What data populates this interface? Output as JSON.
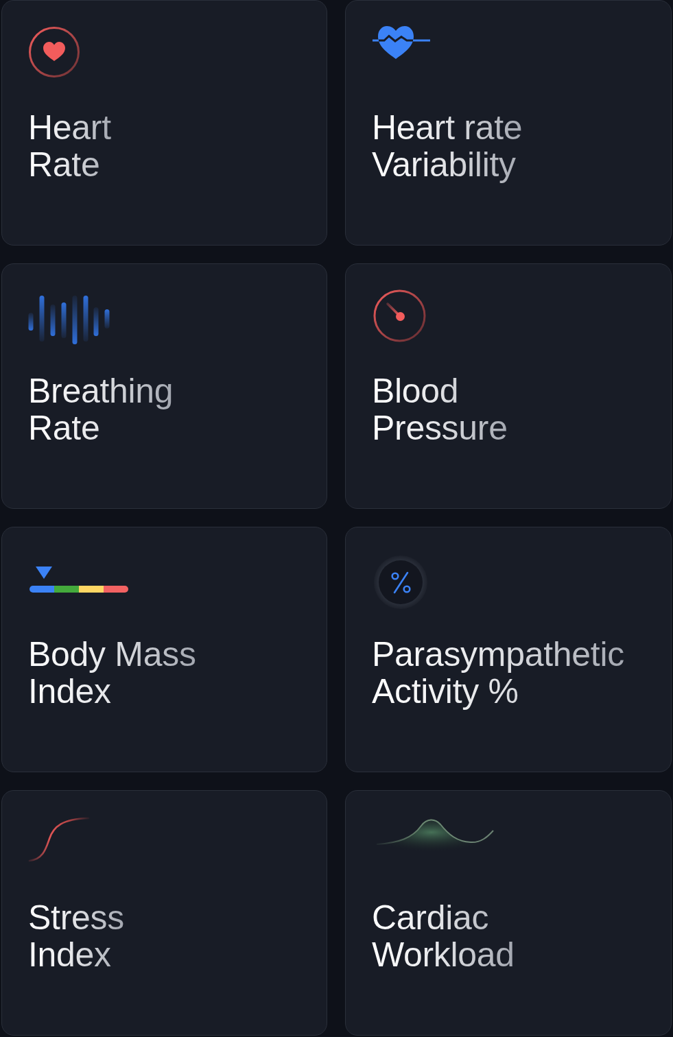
{
  "cards": [
    {
      "kind": "heart_rate",
      "title_lines": [
        "Heart",
        "Rate"
      ]
    },
    {
      "kind": "hrv",
      "title_lines": [
        "Heart rate",
        "Variability"
      ]
    },
    {
      "kind": "breathing",
      "title_lines": [
        "Breathing",
        "Rate"
      ]
    },
    {
      "kind": "blood_pressure",
      "title_lines": [
        "Blood",
        "Pressure"
      ]
    },
    {
      "kind": "bmi",
      "title_lines": [
        "Body Mass",
        "Index"
      ]
    },
    {
      "kind": "parasympathetic",
      "title_lines": [
        "Parasympathetic",
        "Activity %"
      ]
    },
    {
      "kind": "stress",
      "title_lines": [
        "Stress",
        "Index"
      ]
    },
    {
      "kind": "cardiac_workload",
      "title_lines": [
        "Cardiac",
        "Workload"
      ]
    }
  ]
}
